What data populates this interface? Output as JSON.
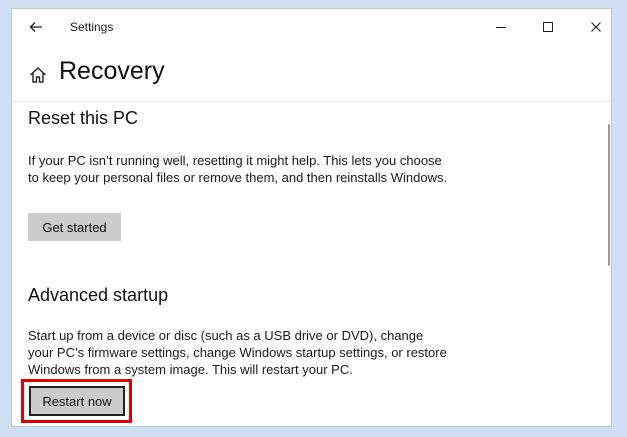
{
  "window": {
    "title": "Settings"
  },
  "header": {
    "title": "Recovery"
  },
  "reset": {
    "title": "Reset this PC",
    "description": "If your PC isn’t running well, resetting it might help. This lets you choose to keep your personal files or remove them, and then reinstalls Windows.",
    "button_label": "Get started"
  },
  "advanced": {
    "title": "Advanced startup",
    "description": "Start up from a device or disc (such as a USB drive or DVD), change your PC’s firmware settings, change Windows startup settings, or restore Windows from a system image. This will restart your PC.",
    "button_label": "Restart now"
  },
  "colors": {
    "highlight": "#e00000",
    "button_bg": "#cccccc",
    "desktop_bg": "#cfe0f4"
  },
  "icons": {
    "back": "back-arrow-icon",
    "home": "home-icon",
    "minimize": "minimize-icon",
    "maximize": "maximize-icon",
    "close": "close-icon"
  }
}
